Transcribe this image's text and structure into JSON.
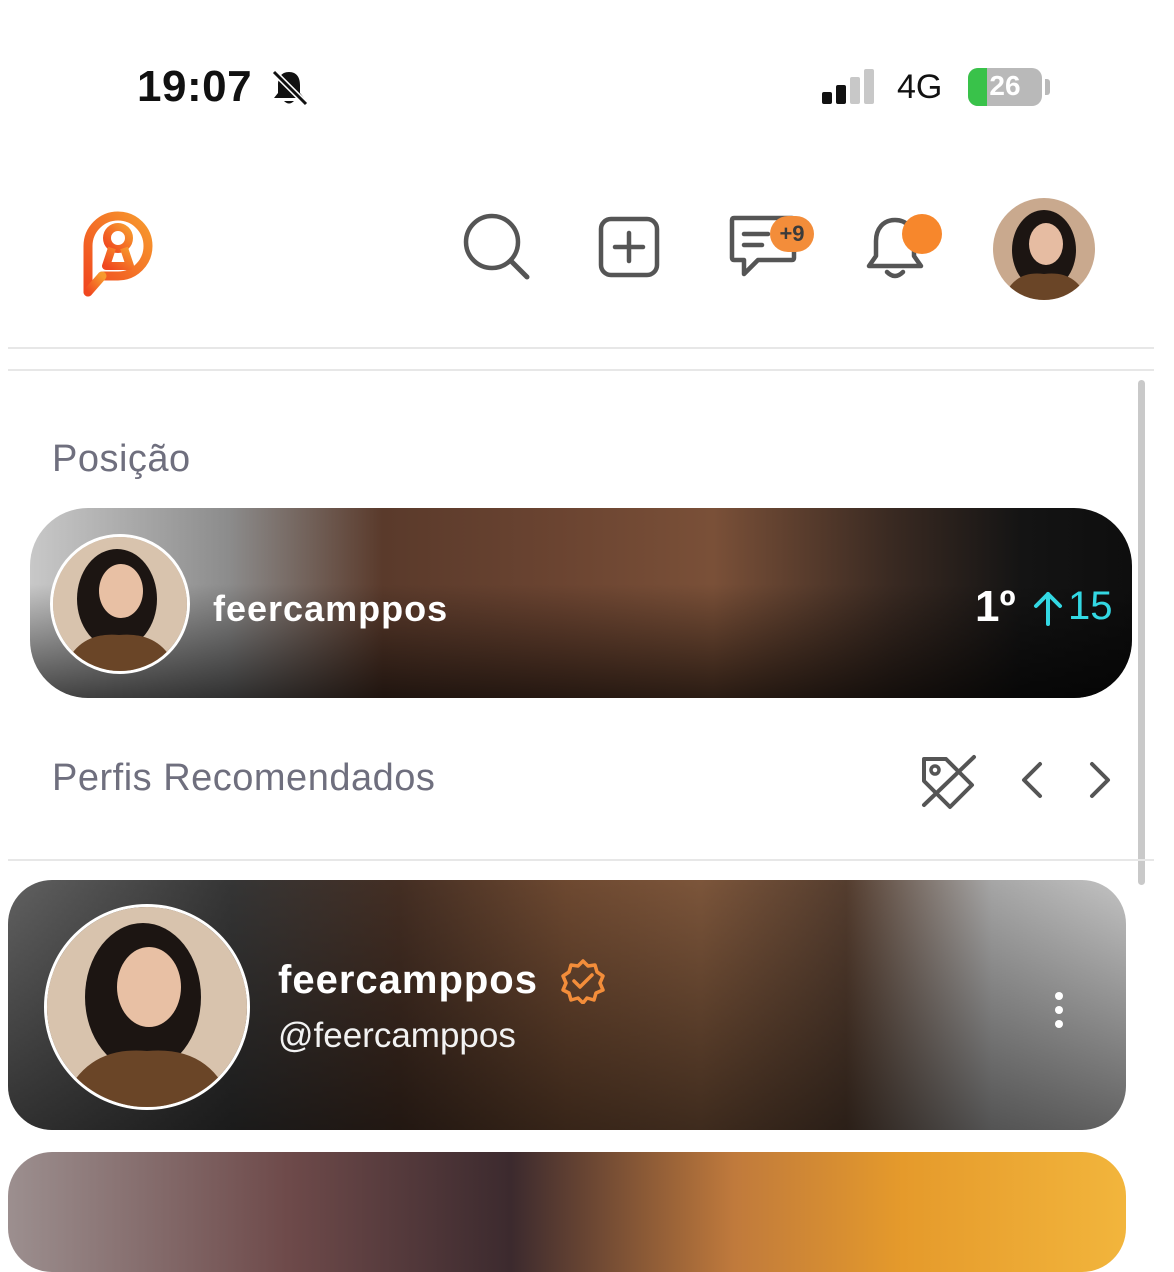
{
  "status_bar": {
    "time": "19:07",
    "network": "4G",
    "battery": "26",
    "battery_level": 0.26
  },
  "header": {
    "messages_badge": "+9",
    "icons": [
      "search-icon",
      "add-post-icon",
      "messages-icon",
      "bell-icon"
    ],
    "accent": "#f7872c"
  },
  "ranking": {
    "title": "Posição",
    "username": "feercamppos",
    "position": "1º",
    "change": "15",
    "change_color": "#33d8e3"
  },
  "recommended": {
    "title": "Perfis Recomendados",
    "profiles": [
      {
        "name": "feercamppos",
        "handle": "@feercamppos"
      }
    ]
  }
}
